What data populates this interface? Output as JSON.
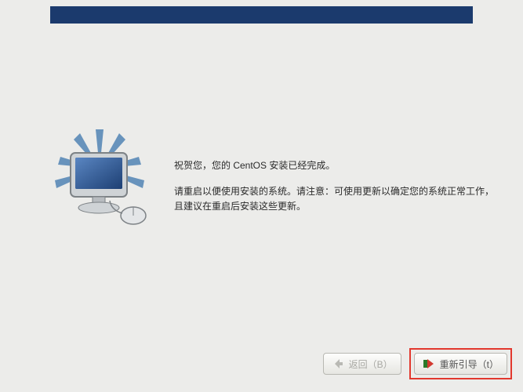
{
  "dialog": {
    "congrats_line": "祝贺您，您的 CentOS 安装已经完成。",
    "instruction_line": "请重启以便使用安装的系统。请注意：可使用更新以确定您的系统正常工作，且建议在重启后安装这些更新。"
  },
  "buttons": {
    "back_label": "返回（B）",
    "reboot_label": "重新引导（t）"
  }
}
